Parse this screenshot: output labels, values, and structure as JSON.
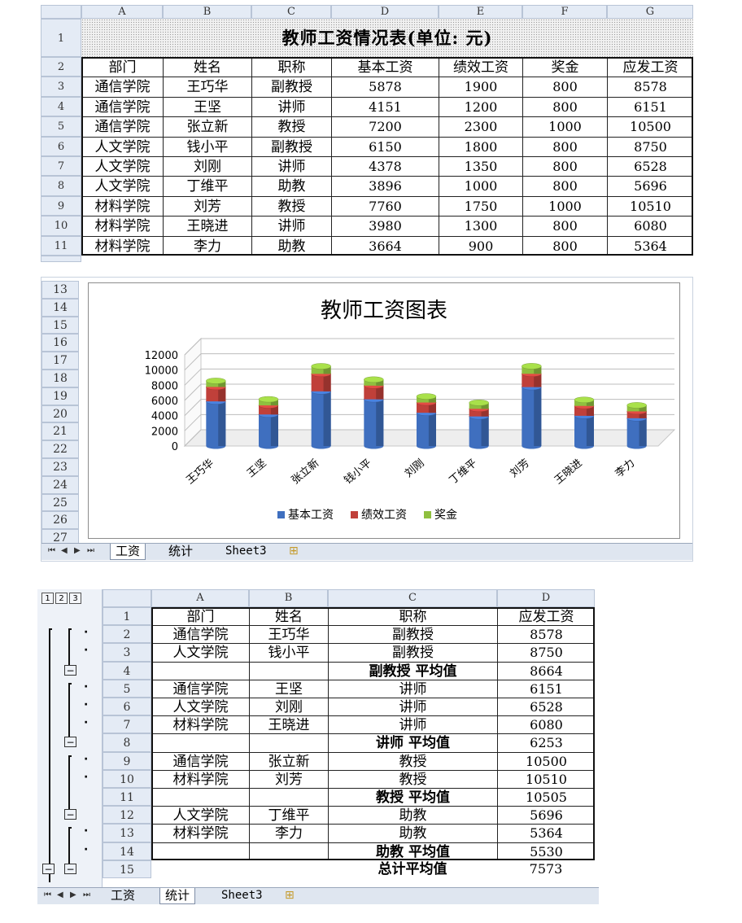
{
  "sheet1": {
    "columns": [
      "A",
      "B",
      "C",
      "D",
      "E",
      "F",
      "G"
    ],
    "title": "教师工资情况表(单位: 元)",
    "headers": [
      "部门",
      "姓名",
      "职称",
      "基本工资",
      "绩效工资",
      "奖金",
      "应发工资"
    ],
    "rows": [
      [
        "通信学院",
        "王巧华",
        "副教授",
        "5878",
        "1900",
        "800",
        "8578"
      ],
      [
        "通信学院",
        "王坚",
        "讲师",
        "4151",
        "1200",
        "800",
        "6151"
      ],
      [
        "通信学院",
        "张立新",
        "教授",
        "7200",
        "2300",
        "1000",
        "10500"
      ],
      [
        "人文学院",
        "钱小平",
        "副教授",
        "6150",
        "1800",
        "800",
        "8750"
      ],
      [
        "人文学院",
        "刘刚",
        "讲师",
        "4378",
        "1350",
        "800",
        "6528"
      ],
      [
        "人文学院",
        "丁维平",
        "助教",
        "3896",
        "1000",
        "800",
        "5696"
      ],
      [
        "材料学院",
        "刘芳",
        "教授",
        "7760",
        "1750",
        "1000",
        "10510"
      ],
      [
        "材料学院",
        "王晓进",
        "讲师",
        "3980",
        "1300",
        "800",
        "6080"
      ],
      [
        "材料学院",
        "李力",
        "助教",
        "3664",
        "900",
        "800",
        "5364"
      ]
    ],
    "row_numbers": [
      "1",
      "2",
      "3",
      "4",
      "5",
      "6",
      "7",
      "8",
      "9",
      "10",
      "11"
    ]
  },
  "chart_sheet": {
    "row_numbers": [
      "13",
      "14",
      "15",
      "16",
      "17",
      "18",
      "19",
      "20",
      "21",
      "22",
      "23",
      "24",
      "25",
      "26",
      "27"
    ],
    "tabs": [
      "工资",
      "统计",
      "Sheet3"
    ],
    "active_tab": 0
  },
  "chart_data": {
    "type": "bar",
    "stacked": true,
    "three_d": true,
    "title": "教师工资图表",
    "categories": [
      "王巧华",
      "王坚",
      "张立新",
      "钱小平",
      "刘刚",
      "丁维平",
      "刘芳",
      "王晓进",
      "李力"
    ],
    "series": [
      {
        "name": "基本工资",
        "color": "#3f6fbf",
        "values": [
          5878,
          4151,
          7200,
          6150,
          4378,
          3896,
          7760,
          3980,
          3664
        ]
      },
      {
        "name": "绩效工资",
        "color": "#c0403a",
        "values": [
          1900,
          1200,
          2300,
          1800,
          1350,
          1000,
          1750,
          1300,
          900
        ]
      },
      {
        "name": "奖金",
        "color": "#8fbf3f",
        "values": [
          800,
          800,
          1000,
          800,
          800,
          800,
          1000,
          800,
          800
        ]
      }
    ],
    "yticks": [
      "0",
      "2000",
      "4000",
      "6000",
      "8000",
      "10000",
      "12000"
    ],
    "ylim": [
      0,
      12000
    ],
    "legend_position": "bottom"
  },
  "sheet2": {
    "columns": [
      "A",
      "B",
      "C",
      "D"
    ],
    "level_buttons": [
      "1",
      "2",
      "3"
    ],
    "headers": [
      "部门",
      "姓名",
      "职称",
      "应发工资"
    ],
    "rows": [
      {
        "n": "2",
        "a": "通信学院",
        "b": "王巧华",
        "c": "副教授",
        "d": "8578",
        "bold": false
      },
      {
        "n": "3",
        "a": "人文学院",
        "b": "钱小平",
        "c": "副教授",
        "d": "8750",
        "bold": false
      },
      {
        "n": "4",
        "a": "",
        "b": "",
        "c": "副教授 平均值",
        "d": "8664",
        "bold": true
      },
      {
        "n": "5",
        "a": "通信学院",
        "b": "王坚",
        "c": "讲师",
        "d": "6151",
        "bold": false
      },
      {
        "n": "6",
        "a": "人文学院",
        "b": "刘刚",
        "c": "讲师",
        "d": "6528",
        "bold": false
      },
      {
        "n": "7",
        "a": "材料学院",
        "b": "王晓进",
        "c": "讲师",
        "d": "6080",
        "bold": false
      },
      {
        "n": "8",
        "a": "",
        "b": "",
        "c": "讲师 平均值",
        "d": "6253",
        "bold": true
      },
      {
        "n": "9",
        "a": "通信学院",
        "b": "张立新",
        "c": "教授",
        "d": "10500",
        "bold": false
      },
      {
        "n": "10",
        "a": "材料学院",
        "b": "刘芳",
        "c": "教授",
        "d": "10510",
        "bold": false
      },
      {
        "n": "11",
        "a": "",
        "b": "",
        "c": "教授 平均值",
        "d": "10505",
        "bold": true
      },
      {
        "n": "12",
        "a": "人文学院",
        "b": "丁维平",
        "c": "助教",
        "d": "5696",
        "bold": false
      },
      {
        "n": "13",
        "a": "材料学院",
        "b": "李力",
        "c": "助教",
        "d": "5364",
        "bold": false
      },
      {
        "n": "14",
        "a": "",
        "b": "",
        "c": "助教 平均值",
        "d": "5530",
        "bold": true
      },
      {
        "n": "15",
        "a": "",
        "b": "",
        "c": "总计平均值",
        "d": "7573",
        "bold": true
      }
    ],
    "tabs": [
      "工资",
      "统计",
      "Sheet3"
    ],
    "active_tab": 1
  }
}
